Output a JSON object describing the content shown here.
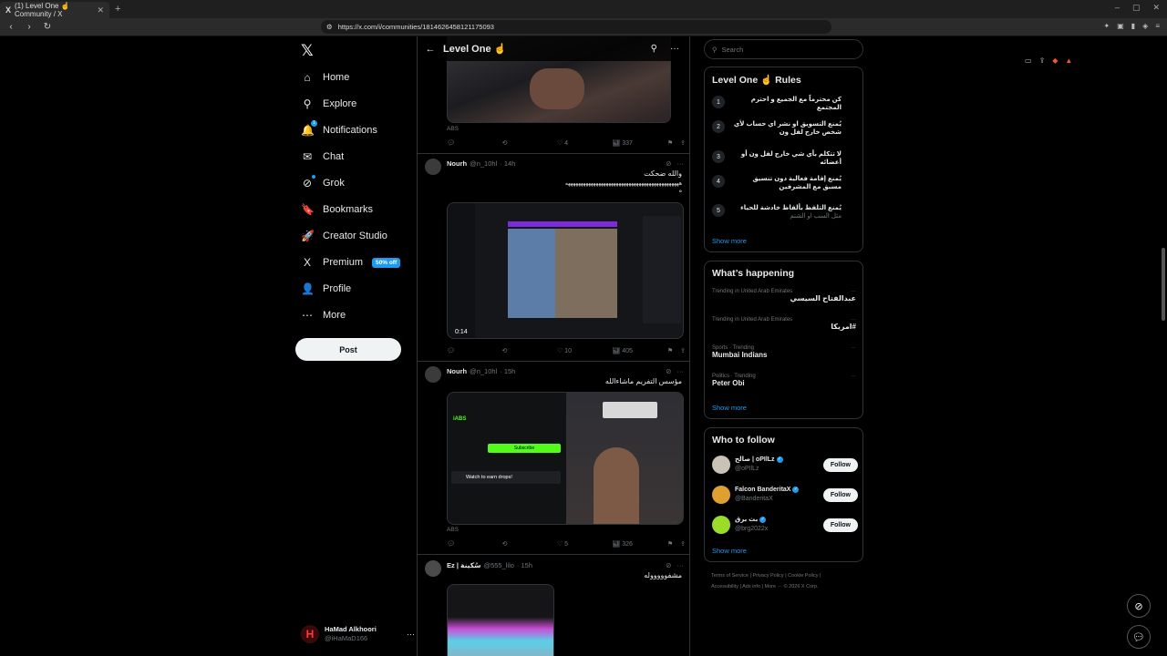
{
  "browser": {
    "tab_title": "(1) Level One ☝️ Community / X",
    "tab_icon": "X",
    "new_tab": "+",
    "url": "https://x.com/i/communities/1814626458121175093"
  },
  "nav": {
    "items": [
      {
        "label": "Home",
        "icon": "⌂"
      },
      {
        "label": "Explore",
        "icon": "⚲"
      },
      {
        "label": "Notifications",
        "icon": "🔔",
        "badge": "1"
      },
      {
        "label": "Chat",
        "icon": "✉"
      },
      {
        "label": "Grok",
        "icon": "⊘"
      },
      {
        "label": "Bookmarks",
        "icon": "🔖"
      },
      {
        "label": "Creator Studio",
        "icon": "🚀"
      },
      {
        "label": "Premium",
        "icon": "X",
        "badge_text": "50% off"
      },
      {
        "label": "Profile",
        "icon": "👤"
      },
      {
        "label": "More",
        "icon": "⋯"
      }
    ],
    "post_label": "Post",
    "account": {
      "name": "HaMad Alkhoori",
      "handle": "@iHaMaD166"
    }
  },
  "main": {
    "title": "Level One ☝️",
    "tweets": [
      {
        "caption": "ABS",
        "replies": "",
        "reposts": "",
        "likes": "4",
        "views": "337"
      },
      {
        "name": "Nourh",
        "handle": "@n_10hl",
        "time": "· 14h",
        "text": "والله ضحكت",
        "text2": "هههههههههههههههههههههههههههههههههههههههههههههه",
        "text3": "ه",
        "video_time": "0:14",
        "likes": "10",
        "views": "405"
      },
      {
        "name": "Nourh",
        "handle": "@n_10hl",
        "time": "· 15h",
        "text": "مؤسس التفريم ماشاءالله",
        "caption": "ABS",
        "panel_user": "iABS",
        "subscribe": "Subscribe",
        "watch_drops": "Watch to earn drops!",
        "likes": "5",
        "views": "326"
      },
      {
        "name": "Ez | سُكينة",
        "handle": "@555_lilo",
        "time": "· 15h",
        "text": "مشفوووووله"
      }
    ]
  },
  "right": {
    "search_placeholder": "Search",
    "rules_title": "Level One ☝️ Rules",
    "rules": [
      {
        "num": "1",
        "text": "كن محترماً مع الجميع و احترم المجتمع",
        "sub": ""
      },
      {
        "num": "2",
        "text": "يُمنع التسويق او نشر اي حساب لأي شخص خارج لفل ون",
        "sub": ""
      },
      {
        "num": "3",
        "text": "لا تتكلم بأي شي خارج لفل ون أو أعضائه",
        "sub": ""
      },
      {
        "num": "4",
        "text": "يُمنع إقامة فعالية دون تنسيق مسبق مع المشرفين",
        "sub": ""
      },
      {
        "num": "5",
        "text": "يُمنع التلفظ بألفاظ خادشة للحياء",
        "sub": "مثل السب او الشتم"
      }
    ],
    "show_more": "Show more",
    "happening_title": "What’s happening",
    "trends": [
      {
        "context": "Trending in United Arab Emirates",
        "name": "عبدالفتاح السيسي",
        "rtl": true
      },
      {
        "context": "Trending in United Arab Emirates",
        "name": "#امريكا",
        "rtl": true
      },
      {
        "context": "Sports · Trending",
        "name": "Mumbai Indians",
        "rtl": false
      },
      {
        "context": "Politics · Trending",
        "name": "Peter Obi",
        "rtl": false
      }
    ],
    "who_title": "Who to follow",
    "follow": [
      {
        "name": "صالح | oPIlLz",
        "handle": "@oPIlLz",
        "color": "#c9c2b5"
      },
      {
        "name": "Falcon BanderitaX",
        "handle": "@BanderitaX",
        "color": "#e0a030"
      },
      {
        "name": "بث برق",
        "handle": "@brg2022x",
        "color": "#9bdc2a"
      }
    ],
    "follow_label": "Follow",
    "footer_line1": "Terms of Service  |  Privacy Policy  |  Cookie Policy  |",
    "footer_line2": "Accessibility  |  Ads info  |  More ···  © 2026 X Corp."
  }
}
